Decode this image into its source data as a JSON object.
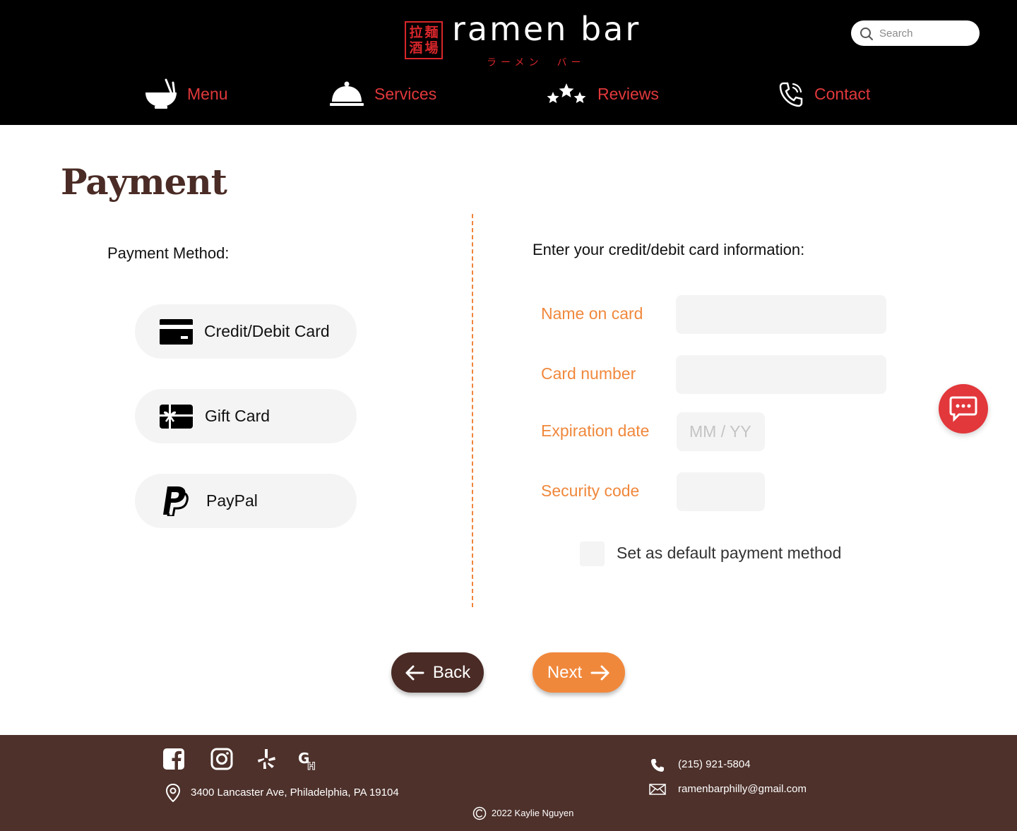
{
  "header": {
    "logo": {
      "seal_chars": [
        "拉",
        "麺",
        "酒",
        "場"
      ],
      "name": "ramen bar",
      "sub": "ラーメン　バー"
    },
    "search": {
      "placeholder": "Search"
    },
    "nav": [
      {
        "label": "Menu",
        "icon": "ramen-bowl-icon"
      },
      {
        "label": "Services",
        "icon": "cloche-icon"
      },
      {
        "label": "Reviews",
        "icon": "stars-icon"
      },
      {
        "label": "Contact",
        "icon": "phone-icon"
      }
    ]
  },
  "main": {
    "title": "Payment",
    "payment_method_label": "Payment Method:",
    "methods": [
      {
        "label": "Credit/Debit Card",
        "icon": "credit-card-icon"
      },
      {
        "label": "Gift Card",
        "icon": "gift-card-icon"
      },
      {
        "label": "PayPal",
        "icon": "paypal-icon"
      }
    ],
    "card_form": {
      "heading": "Enter your credit/debit card information:",
      "name_label": "Name on card",
      "number_label": "Card number",
      "expiry_label": "Expiration date",
      "expiry_placeholder": "MM / YY",
      "security_label": "Security code",
      "default_label": "Set as default payment method"
    },
    "buttons": {
      "back": "Back",
      "next": "Next"
    }
  },
  "footer": {
    "social": [
      "facebook-icon",
      "instagram-icon",
      "yelp-icon",
      "grubhub-icon"
    ],
    "address": "3400 Lancaster Ave, Philadelphia, PA 19104",
    "phone": "(215) 921-5804",
    "email": "ramenbarphilly@gmail.com",
    "copyright": "2022 Kaylie Nguyen"
  },
  "colors": {
    "header_bg": "#000000",
    "nav_text": "#e0383b",
    "accent_orange": "#f0883c",
    "brown": "#4a2b25",
    "footer_bg": "#4e312b",
    "chat_red": "#e2373b",
    "field_bg": "#f4f4f4"
  }
}
